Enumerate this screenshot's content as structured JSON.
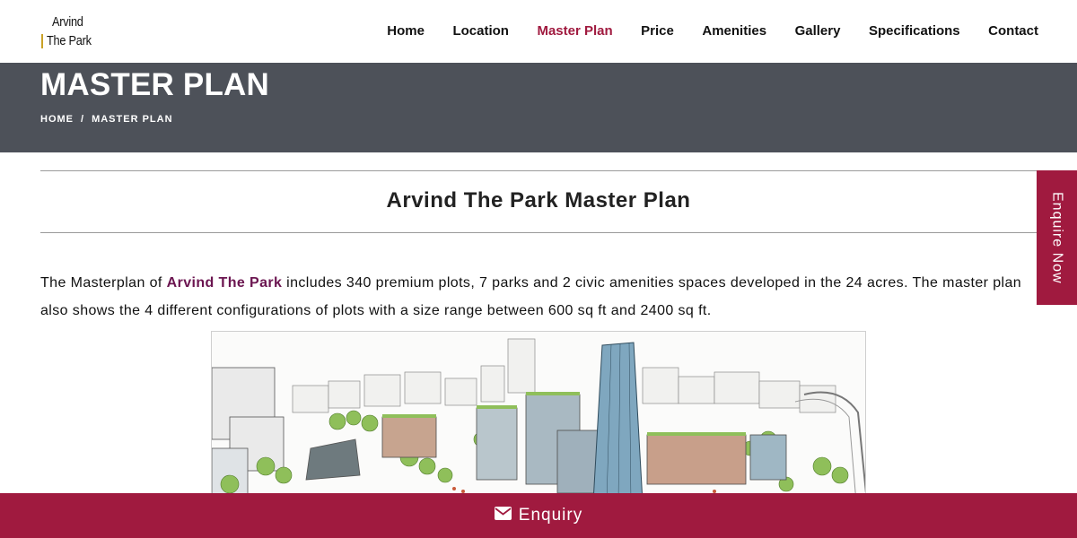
{
  "brand": {
    "line1": "Arvind",
    "line2": "The Park"
  },
  "nav": {
    "items": [
      {
        "label": "Home",
        "active": false
      },
      {
        "label": "Location",
        "active": false
      },
      {
        "label": "Master Plan",
        "active": true
      },
      {
        "label": "Price",
        "active": false
      },
      {
        "label": "Amenities",
        "active": false
      },
      {
        "label": "Gallery",
        "active": false
      },
      {
        "label": "Specifications",
        "active": false
      },
      {
        "label": "Contact",
        "active": false
      }
    ]
  },
  "banner": {
    "title": "MASTER PLAN",
    "breadcrumb": {
      "home": "HOME",
      "separator": "/",
      "current": "MASTER PLAN"
    }
  },
  "section": {
    "title": "Arvind The Park Master Plan",
    "description": {
      "before": "The Masterplan of ",
      "highlight": "Arvind The Park",
      "after": " includes 340 premium plots, 7 parks and 2 civic amenities spaces developed in the 24 acres. The master plan also shows the 4 different configurations of plots with a size range between 600 sq ft and 2400 sq ft."
    }
  },
  "side_tab": {
    "label": "Enquire Now"
  },
  "bottom_bar": {
    "icon": "envelope-icon",
    "label": "Enquiry"
  },
  "colors": {
    "accent": "#a01a3f",
    "banner": "#4d5159",
    "highlight": "#6b1550"
  }
}
